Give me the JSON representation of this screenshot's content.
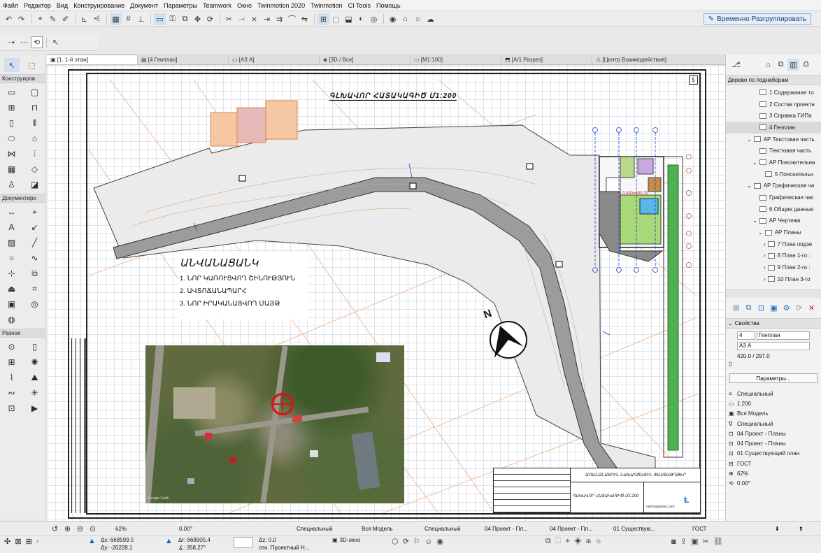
{
  "menu": [
    "Файл",
    "Редактор",
    "Вид",
    "Конструирование",
    "Документ",
    "Параметры",
    "Teamwork",
    "Окно",
    "Twinmotion 2020",
    "Twinmotion",
    "CI Tools",
    "Помощь"
  ],
  "toolbar": {
    "ungroup_label": "Временно Разгруппировать"
  },
  "tabs": [
    {
      "label": "[1. 1-й этаж]",
      "active": true
    },
    {
      "label": "[4 Генплан]",
      "active": false
    },
    {
      "label": "[А3 А]",
      "active": false
    },
    {
      "label": "[3D / Все]",
      "active": false
    },
    {
      "label": "[M1:100]",
      "active": false
    },
    {
      "label": "[А/1 Разрез]",
      "active": false
    },
    {
      "label": "[Центр Взаимодействия]",
      "active": false
    }
  ],
  "left_toolbox": {
    "sections": [
      "Конструиров",
      "Документиро",
      "Разное"
    ]
  },
  "drawing": {
    "title": "ԳԼԽԱՎՈՐ ՀԱՏԱԿԱԳԻԾ  Մ1:200",
    "legend_title": "ԱՆՎԱՆԱՑԱՆԿ",
    "legend_items": [
      "1. ՆՈՐ ԿԱՌՈՒՑՎՈՂ ՇԻՆՈՒԹՅՈՒՆ",
      "2. ԱՎՏՈՃԱՆԱՊԱՐՀ",
      "3. ՆՈՐ ԻՐԱԿԱՆԱՑՎՈՂ ՄԱՅԹ"
    ],
    "north": "N",
    "elevation": "0.000=800.70",
    "stamp_title": "ԱՌԱՆՁՆԱՏՈՒՆ ՆԱԽԱԳԾԱՅԻՆ ՓԱՍՏԱԹՂԹԵՐ",
    "stamp_sub": "ԳԼԽԱՎՈՐ ՀԱՏԱԿԱԳԻԾ  Մ1:200",
    "stamp_site": "nairisargsyan.com",
    "page_number": "5",
    "map_credit": "Google Earth"
  },
  "navigator": {
    "header": "Дерево по поднаборам",
    "items": [
      {
        "label": "1 Содержание то",
        "indent": 3,
        "selected": false
      },
      {
        "label": "2 Состав проектн",
        "indent": 3,
        "selected": false
      },
      {
        "label": "3 Справка ГИПа",
        "indent": 3,
        "selected": false
      },
      {
        "label": "4 Генплан",
        "indent": 3,
        "selected": true
      },
      {
        "label": "АР Текстовая часть",
        "indent": 1,
        "selected": false
      },
      {
        "label": "Текстовая часть",
        "indent": 2,
        "selected": false
      },
      {
        "label": "АР Пояснительна",
        "indent": 2,
        "selected": false
      },
      {
        "label": "5 Пояснительн",
        "indent": 3,
        "selected": false
      },
      {
        "label": "АР Графическая ча",
        "indent": 1,
        "selected": false
      },
      {
        "label": "Графическая час",
        "indent": 2,
        "selected": false
      },
      {
        "label": "6 Общие данные",
        "indent": 2,
        "selected": false
      },
      {
        "label": "АР Чертежи",
        "indent": 2,
        "selected": false
      },
      {
        "label": "АР Планы",
        "indent": 3,
        "selected": false
      },
      {
        "label": "7 План подзе",
        "indent": 4,
        "selected": false
      },
      {
        "label": "8 План 1-го :",
        "indent": 4,
        "selected": false
      },
      {
        "label": "9 План 2-го :",
        "indent": 4,
        "selected": false
      },
      {
        "label": "10 План 3-го",
        "indent": 4,
        "selected": false
      }
    ]
  },
  "properties": {
    "header": "Свойства",
    "number": "4",
    "name": "Генплан",
    "layout": "А3 А",
    "size": "420.0 / 297.0",
    "params_button": "Параметры...",
    "rows": [
      "Специальный",
      "1:200",
      "Вся Модель",
      "Специальный",
      "04 Проект - Планы",
      "04 Проект - Планы",
      "01 Существующий план",
      "ГОСТ",
      "62%",
      "0.00°"
    ]
  },
  "status": {
    "zoom": "62%",
    "angle": "0.00°",
    "layer_combo": "Специальный",
    "model": "Вся Модель",
    "pen": "Специальный",
    "plan1": "04 Проект - Пл...",
    "plan2": "04 Проект - Пл...",
    "existing": "01 Существую...",
    "standard": "ГОСТ",
    "dx": "Δx: 668599.5",
    "dy": "Δy: -20228.1",
    "dr": "Δr: 668905.4",
    "da": "∡: 358.27°",
    "dz": "Δz: 0.0",
    "ref": "отн. Проектный Н...",
    "view3d": "3D-окно"
  }
}
